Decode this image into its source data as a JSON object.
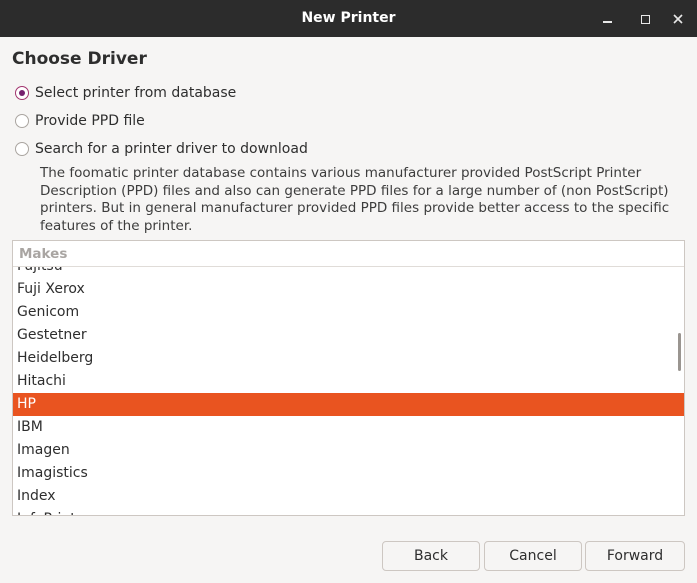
{
  "window": {
    "title": "New Printer",
    "controls": {
      "minimize": "minimize-icon",
      "maximize": "maximize-icon",
      "close": "close-icon"
    }
  },
  "page": {
    "heading": "Choose Driver",
    "options": [
      {
        "label": "Select printer from database",
        "checked": true
      },
      {
        "label": "Provide PPD file",
        "checked": false
      },
      {
        "label": "Search for a printer driver to download",
        "checked": false
      }
    ],
    "description": "The foomatic printer database contains various manufacturer provided PostScript Printer Description (PPD) files and also can generate PPD files for a large number of (non PostScript) printers. But in general manufacturer provided PPD files provide better access to the specific features of the printer."
  },
  "makes": {
    "header": "Makes",
    "items": [
      "Fujitsu",
      "Fuji Xerox",
      "Genicom",
      "Gestetner",
      "Heidelberg",
      "Hitachi",
      "HP",
      "IBM",
      "Imagen",
      "Imagistics",
      "Index",
      "InfoPrint"
    ],
    "selected": "HP"
  },
  "buttons": {
    "back": "Back",
    "cancel": "Cancel",
    "forward": "Forward"
  },
  "colors": {
    "selection": "#e95420",
    "radio_accent": "#77216f",
    "titlebar": "#2c2c2c"
  }
}
